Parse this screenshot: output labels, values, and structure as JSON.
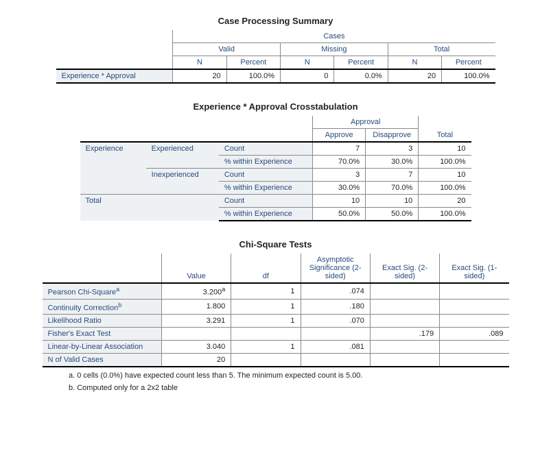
{
  "t1": {
    "title": "Case Processing Summary",
    "h_cases": "Cases",
    "h_valid": "Valid",
    "h_missing": "Missing",
    "h_total": "Total",
    "h_n": "N",
    "h_pct": "Percent",
    "rowlabel": "Experience * Approval",
    "valid_n": "20",
    "valid_p": "100.0%",
    "missing_n": "0",
    "missing_p": "0.0%",
    "total_n": "20",
    "total_p": "100.0%"
  },
  "t2": {
    "title": "Experience * Approval Crosstabulation",
    "h_approval": "Approval",
    "h_approve": "Approve",
    "h_disapprove": "Disapprove",
    "h_total": "Total",
    "rl_experience": "Experience",
    "rl_experienced": "Experienced",
    "rl_inexperienced": "Inexperienced",
    "rl_total": "Total",
    "rl_count": "Count",
    "rl_pct": "% within Experience",
    "r1c": {
      "a": "7",
      "d": "3",
      "t": "10"
    },
    "r1p": {
      "a": "70.0%",
      "d": "30.0%",
      "t": "100.0%"
    },
    "r2c": {
      "a": "3",
      "d": "7",
      "t": "10"
    },
    "r2p": {
      "a": "30.0%",
      "d": "70.0%",
      "t": "100.0%"
    },
    "r3c": {
      "a": "10",
      "d": "10",
      "t": "20"
    },
    "r3p": {
      "a": "50.0%",
      "d": "50.0%",
      "t": "100.0%"
    }
  },
  "t3": {
    "title": "Chi-Square Tests",
    "h_value": "Value",
    "h_df": "df",
    "h_asymp": "Asymptotic Significance (2-sided)",
    "h_ex2": "Exact Sig. (2-sided)",
    "h_ex1": "Exact Sig. (1-sided)",
    "r1": {
      "label": "Pearson Chi-Square",
      "sup": "a",
      "v": "3.200",
      "df": "1",
      "as": ".074",
      "e2": "",
      "e1": ""
    },
    "r2": {
      "label": "Continuity Correction",
      "sup": "b",
      "v": "1.800",
      "df": "1",
      "as": ".180",
      "e2": "",
      "e1": ""
    },
    "r3": {
      "label": "Likelihood Ratio",
      "sup": "",
      "v": "3.291",
      "df": "1",
      "as": ".070",
      "e2": "",
      "e1": ""
    },
    "r4": {
      "label": "Fisher's Exact Test",
      "sup": "",
      "v": "",
      "df": "",
      "as": "",
      "e2": ".179",
      "e1": ".089"
    },
    "r5": {
      "label": "Linear-by-Linear Association",
      "sup": "",
      "v": "3.040",
      "df": "1",
      "as": ".081",
      "e2": "",
      "e1": ""
    },
    "r6": {
      "label": "N of Valid Cases",
      "sup": "",
      "v": "20",
      "df": "",
      "as": "",
      "e2": "",
      "e1": ""
    },
    "fn_a": "a. 0 cells (0.0%) have expected count less than 5. The minimum expected count is 5.00.",
    "fn_b": "b. Computed only for a 2x2 table"
  }
}
